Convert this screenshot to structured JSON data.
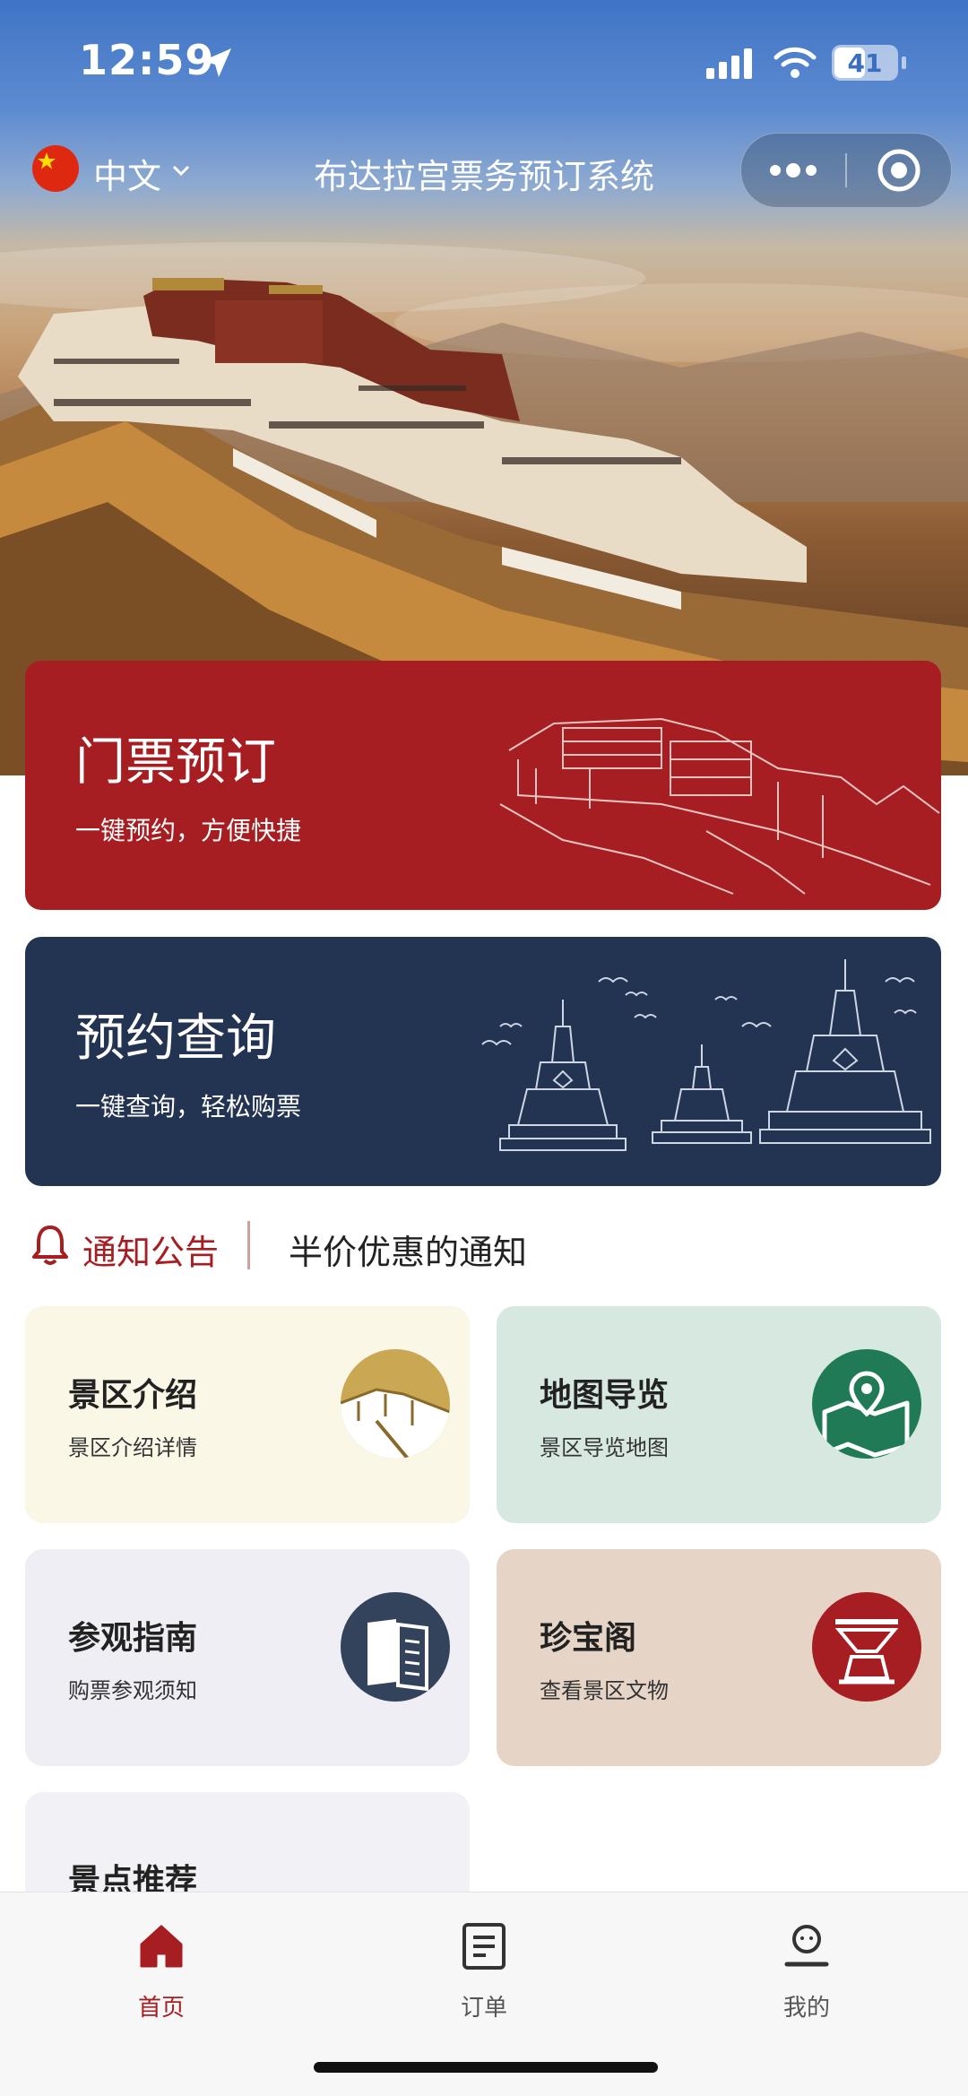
{
  "status_bar": {
    "time": "12:59",
    "battery": "41",
    "icons": [
      "location-arrow-icon",
      "cellular-signal-icon",
      "wifi-icon",
      "battery-icon"
    ]
  },
  "nav": {
    "language": "中文",
    "title": "布达拉宫票务预订系统",
    "icons": [
      "china-flag-icon",
      "chevron-down-icon",
      "more-dots-icon",
      "close-target-icon"
    ]
  },
  "cards": [
    {
      "title": "门票预订",
      "subtitle": "一键预约，方便快捷",
      "color": "#a61e22"
    },
    {
      "title": "预约查询",
      "subtitle": "一键查询，轻松购票",
      "color": "#233352"
    }
  ],
  "notice": {
    "label": "通知公告",
    "text": "半价优惠的通知",
    "color": "#a61e22"
  },
  "tiles": [
    {
      "title": "景区介绍",
      "subtitle": "景区介绍详情",
      "bg": "#faf7e6",
      "icon": "palace-icon"
    },
    {
      "title": "地图导览",
      "subtitle": "景区导览地图",
      "bg": "#d6e8e0",
      "icon": "map-icon"
    },
    {
      "title": "参观指南",
      "subtitle": "购票参观须知",
      "bg": "#eeeef4",
      "icon": "guide-book-icon"
    },
    {
      "title": "珍宝阁",
      "subtitle": "查看景区文物",
      "bg": "#e6d5c7",
      "icon": "treasure-icon"
    },
    {
      "title": "景点推荐",
      "bg": "#f2f2f6"
    }
  ],
  "tabbar": {
    "active_color": "#a61e22",
    "items": [
      {
        "label": "首页",
        "icon": "home-icon",
        "active": true
      },
      {
        "label": "订单",
        "icon": "order-list-icon",
        "active": false
      },
      {
        "label": "我的",
        "icon": "profile-icon",
        "active": false
      }
    ]
  }
}
